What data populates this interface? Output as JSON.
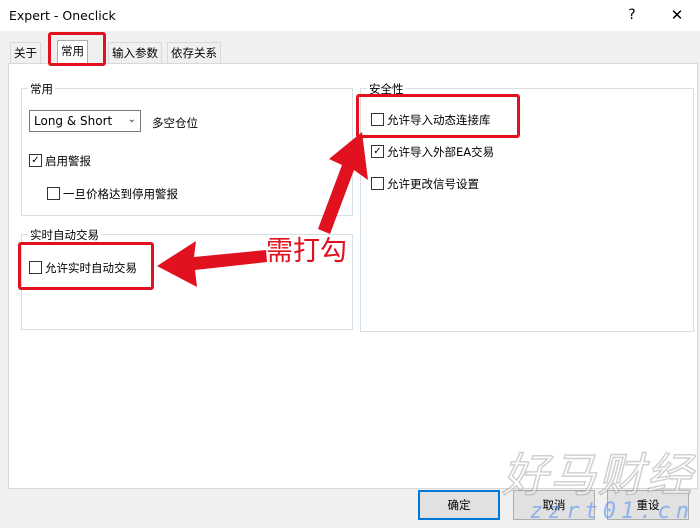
{
  "window": {
    "title": "Expert - Oneclick",
    "help_glyph": "?",
    "close_glyph": "✕"
  },
  "tabs": [
    {
      "label": "关于"
    },
    {
      "label": "常用"
    },
    {
      "label": "输入参数"
    },
    {
      "label": "依存关系"
    }
  ],
  "common_group": {
    "title": "常用",
    "position_select": {
      "value": "Long & Short",
      "label": "多空仓位"
    },
    "enable_alerts": {
      "label": "启用警报",
      "mark": "✓"
    },
    "disable_alert_on_stop": {
      "label": "一旦价格达到停用警报",
      "mark": ""
    }
  },
  "auto_trading_group": {
    "title": "实时自动交易",
    "allow_live_trading": {
      "label": "允许实时自动交易",
      "mark": ""
    }
  },
  "security_group": {
    "title": "安全性",
    "allow_dll_import": {
      "label": "允许导入动态连接库",
      "mark": ""
    },
    "allow_ea_import": {
      "label": "允许导入外部EA交易",
      "mark": "✓"
    },
    "allow_signal_change": {
      "label": "允许更改信号设置",
      "mark": ""
    }
  },
  "annotation": {
    "text": "需打勾",
    "color": "#e1111f"
  },
  "buttons": {
    "ok": "确定",
    "cancel": "取消",
    "reset": "重设"
  },
  "watermark": {
    "cn": "好马财经",
    "en": "zzrt01.cn"
  },
  "colors": {
    "accent": "#0078d7",
    "annotation_red": "#e1111f"
  }
}
